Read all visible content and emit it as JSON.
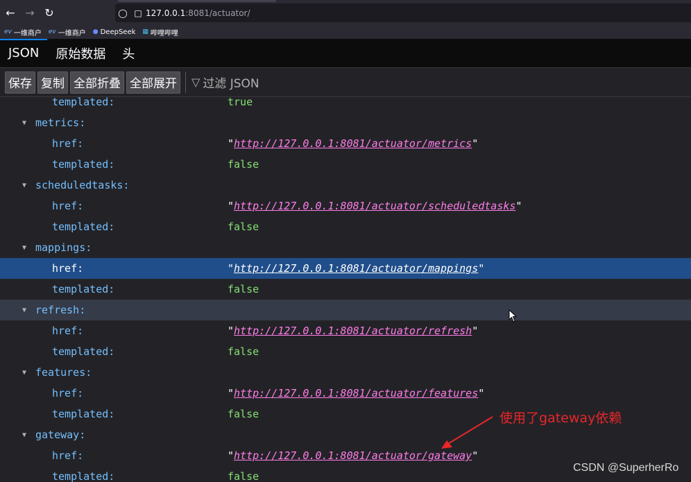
{
  "browser": {
    "url_host": "127.0.0.1",
    "url_rest": ":8081/actuator/",
    "bookmarks": [
      {
        "icon": "ev",
        "label": "一维商户"
      },
      {
        "icon": "ev",
        "label": "一维商户"
      },
      {
        "icon": "deepseek-icon",
        "label": "DeepSeek"
      },
      {
        "icon": "bilibili-icon",
        "label": "哔哩哔哩"
      }
    ]
  },
  "viewer": {
    "tabs": [
      {
        "label": "JSON",
        "selected": true
      },
      {
        "label": "原始数据",
        "selected": false
      },
      {
        "label": "头",
        "selected": false
      }
    ],
    "actions": {
      "save": "保存",
      "copy": "复制",
      "collapse_all": "全部折叠",
      "expand_all": "全部展开",
      "filter_placeholder": "过滤 JSON"
    }
  },
  "tree": [
    {
      "level": 2,
      "key": "templated:",
      "value": "true",
      "type": "bool"
    },
    {
      "level": 1,
      "key": "metrics:",
      "type": "object"
    },
    {
      "level": 2,
      "key": "href:",
      "value": "http://127.0.0.1:8081/actuator/metrics",
      "type": "str"
    },
    {
      "level": 2,
      "key": "templated:",
      "value": "false",
      "type": "bool"
    },
    {
      "level": 1,
      "key": "scheduledtasks:",
      "type": "object"
    },
    {
      "level": 2,
      "key": "href:",
      "value": "http://127.0.0.1:8081/actuator/scheduledtasks",
      "type": "str"
    },
    {
      "level": 2,
      "key": "templated:",
      "value": "false",
      "type": "bool"
    },
    {
      "level": 1,
      "key": "mappings:",
      "type": "object"
    },
    {
      "level": 2,
      "key": "href:",
      "value": "http://127.0.0.1:8081/actuator/mappings",
      "type": "str",
      "state": "selected"
    },
    {
      "level": 2,
      "key": "templated:",
      "value": "false",
      "type": "bool"
    },
    {
      "level": 1,
      "key": "refresh:",
      "type": "object",
      "state": "hover"
    },
    {
      "level": 2,
      "key": "href:",
      "value": "http://127.0.0.1:8081/actuator/refresh",
      "type": "str"
    },
    {
      "level": 2,
      "key": "templated:",
      "value": "false",
      "type": "bool"
    },
    {
      "level": 1,
      "key": "features:",
      "type": "object"
    },
    {
      "level": 2,
      "key": "href:",
      "value": "http://127.0.0.1:8081/actuator/features",
      "type": "str"
    },
    {
      "level": 2,
      "key": "templated:",
      "value": "false",
      "type": "bool"
    },
    {
      "level": 1,
      "key": "gateway:",
      "type": "object"
    },
    {
      "level": 2,
      "key": "href:",
      "value": "http://127.0.0.1:8081/actuator/gateway",
      "type": "str"
    },
    {
      "level": 2,
      "key": "templated:",
      "value": "false",
      "type": "bool"
    }
  ],
  "annotation": "使用了gateway依赖",
  "watermark": "CSDN @SuperherRo",
  "colors": {
    "key": "#75bfff",
    "bool": "#86de74",
    "link": "#ff7de9",
    "selected_row": "#204e8a",
    "annotation": "#e8262b"
  }
}
